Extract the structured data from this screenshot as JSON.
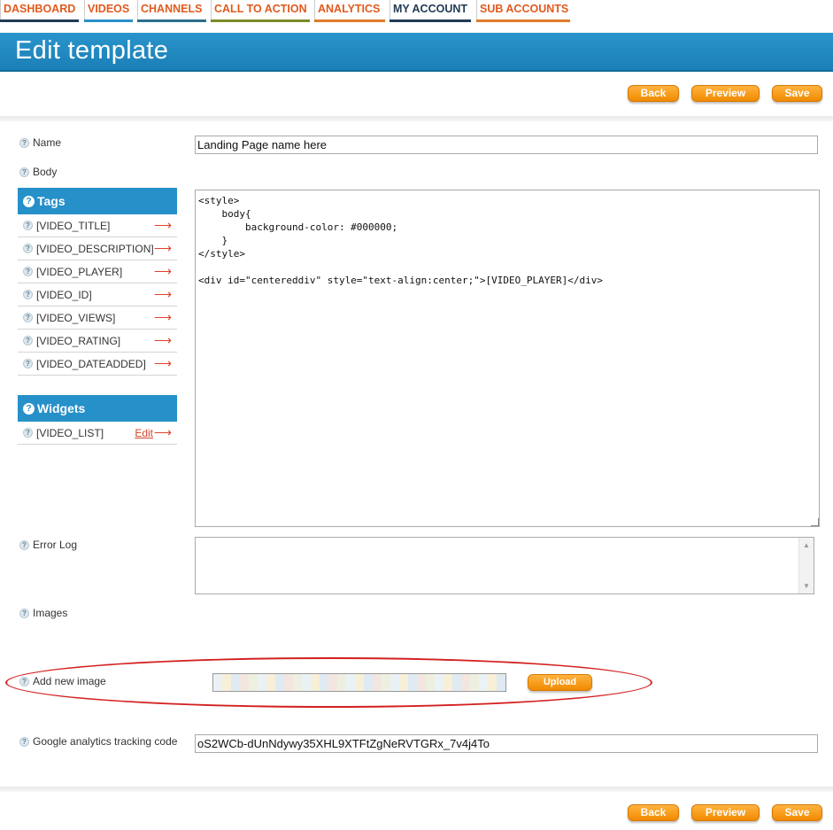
{
  "nav": {
    "tabs": [
      {
        "label": "Dashboard",
        "color": "#e05a1e",
        "bar": "#223a55"
      },
      {
        "label": "Videos",
        "color": "#e05a1e",
        "bar": "#2a8fc8"
      },
      {
        "label": "Channels",
        "color": "#e05a1e",
        "bar": "#2b6f88"
      },
      {
        "label": "Call to Action",
        "color": "#e05a1e",
        "bar": "#7a8a2a"
      },
      {
        "label": "Analytics",
        "color": "#e05a1e",
        "bar": "#e07a2a"
      },
      {
        "label": "My Account",
        "color": "#223a55",
        "bar": "#223a55"
      },
      {
        "label": "Sub Accounts",
        "color": "#e05a1e",
        "bar": "#e07a2a"
      }
    ]
  },
  "header": {
    "title": "Edit template"
  },
  "actions": {
    "back": "Back",
    "preview": "Preview",
    "save": "Save"
  },
  "form": {
    "name_label": "Name",
    "name_value": "Landing Page name here",
    "body_label": "Body",
    "body_code": "<style>\n    body{\n        background-color: #000000;\n    }\n</style>\n\n<div id=\"centereddiv\" style=\"text-align:center;\">[VIDEO_PLAYER]</div>",
    "error_log_label": "Error Log",
    "images_label": "Images",
    "add_image_label": "Add new image",
    "upload_label": "Upload",
    "ga_label": "Google analytics tracking code",
    "ga_value": "oS2WCb-dUnNdywy35XHL9XTFtZgNeRVTGRx_7v4j4To"
  },
  "tags": {
    "title": "Tags",
    "items": [
      "[VIDEO_TITLE]",
      "[VIDEO_DESCRIPTION]",
      "[VIDEO_PLAYER]",
      "[VIDEO_ID]",
      "[VIDEO_VIEWS]",
      "[VIDEO_RATING]",
      "[VIDEO_DATEADDED]"
    ]
  },
  "widgets": {
    "title": "Widgets",
    "items": [
      {
        "label": "[VIDEO_LIST]",
        "edit": "Edit"
      }
    ]
  }
}
